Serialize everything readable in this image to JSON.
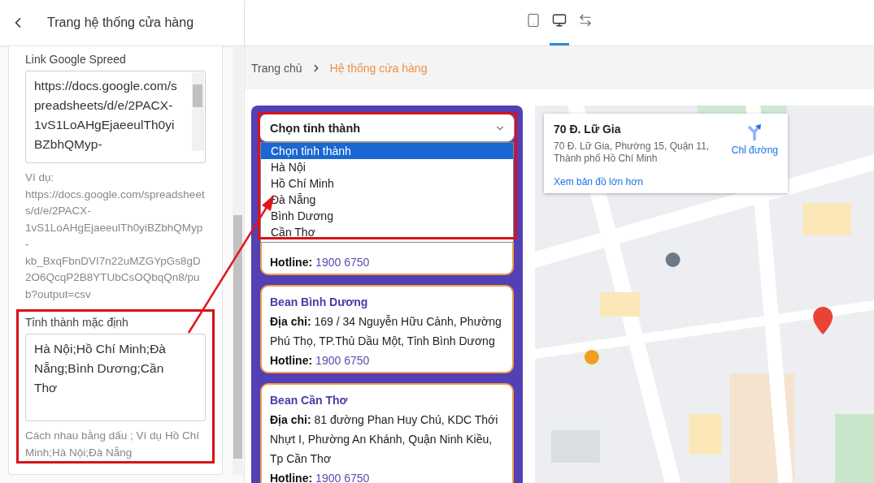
{
  "sidebar": {
    "title": "Trang hệ thống cửa hàng",
    "fields": [
      {
        "label": "Link Google Spreed",
        "value": "https://docs.google.com/spreadsheets/d/e/2PACX-1vS1LoAHgEjaeeulTh0yiBZbhQMyp-",
        "hint": "Ví dụ: https://docs.google.com/spreadsheets/d/e/2PACX-1vS1LoAHgEjaeeulTh0yiBZbhQMyp-kb_BxqFbnDVI7n22uMZGYpGs8gD2O6QcqP2B8YTUbCsOQbqQn8/pub?output=csv",
        "scrollbar": true,
        "highlighted": false
      },
      {
        "label": "Tỉnh thành mặc định",
        "value": "Hà Nội;Hồ Chí Minh;Đà Nẵng;Bình Dương;Cần Thơ",
        "hint": "Cách nhau bằng dấu ; Ví dụ Hồ Chí Minh;Hà Nội;Đà Nẵng",
        "scrollbar": false,
        "highlighted": true
      }
    ]
  },
  "toolbar": {
    "devices": [
      {
        "kind": "tablet",
        "selected": false
      },
      {
        "kind": "desktop",
        "selected": true
      },
      {
        "kind": "fit",
        "selected": false
      }
    ]
  },
  "breadcrumb": [
    {
      "label": "Trang chủ",
      "current": false
    },
    {
      "label": "Hệ thống cửa hàng",
      "current": true
    }
  ],
  "province_select": {
    "value": "Chọn tỉnh thành",
    "expanded": true,
    "options": [
      {
        "label": "Chọn tỉnh thành",
        "selected": true
      },
      {
        "label": "Hà Nội",
        "selected": false
      },
      {
        "label": "Hồ Chí Minh",
        "selected": false
      },
      {
        "label": "Đà Nẵng",
        "selected": false
      },
      {
        "label": "Bình Dương",
        "selected": false
      },
      {
        "label": "Cần Thơ",
        "selected": false
      }
    ]
  },
  "stores": [
    {
      "hotline_label": "Hotline:",
      "hotline": "1900 6750"
    },
    {
      "name": "Bean Bình Dương",
      "address": "**Địa chỉ:** 169 / 34 Nguyễn Hữu Cảnh, Phường Phú Thọ, TP.Thủ Dầu Một, Tỉnh Bình Dương",
      "hotline_label": "Hotline:",
      "hotline": "1900 6750"
    },
    {
      "name": "Bean Cần Thơ",
      "address": "**Địa chỉ:** 81 đường Phan Huy Chú, KDC Thới Nhựt I, Phường An Khánh, Quận Ninh Kiều, Tp Cần Thơ",
      "hotline_label": "Hotline:",
      "hotline": "1900 6750"
    }
  ],
  "map": {
    "info": {
      "title": "70 Đ. Lữ Gia",
      "address": "70 Đ. Lữ Gia, Phường 15, Quận 11, Thành phố Hồ Chí Minh",
      "directions": "Chỉ đường",
      "link": "Xem bản đồ lớn hơn"
    }
  }
}
